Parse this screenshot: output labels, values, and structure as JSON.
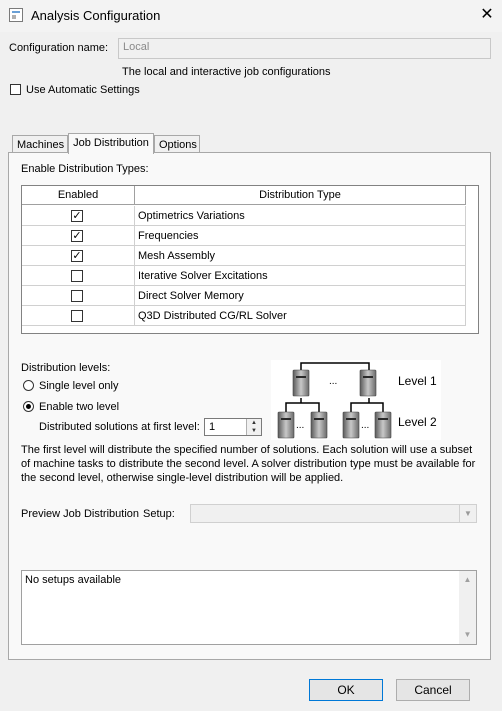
{
  "window": {
    "title": "Analysis Configuration",
    "close_label": "✕"
  },
  "config": {
    "name_label": "Configuration name:",
    "name_value": "Local",
    "description": "The local and interactive job configurations",
    "auto_settings_label": "Use Automatic Settings"
  },
  "tabs": [
    {
      "label": "Machines",
      "active": false
    },
    {
      "label": "Job Distribution",
      "active": true
    },
    {
      "label": "Options",
      "active": false
    }
  ],
  "distribution": {
    "section_label": "Enable Distribution Types:",
    "columns": [
      "Enabled",
      "Distribution Type"
    ],
    "rows": [
      {
        "enabled": true,
        "type": "Optimetrics Variations"
      },
      {
        "enabled": true,
        "type": "Frequencies"
      },
      {
        "enabled": true,
        "type": "Mesh Assembly"
      },
      {
        "enabled": false,
        "type": "Iterative Solver Excitations"
      },
      {
        "enabled": false,
        "type": "Direct Solver Memory"
      },
      {
        "enabled": false,
        "type": "Q3D Distributed CG/RL Solver"
      }
    ]
  },
  "levels": {
    "label": "Distribution levels:",
    "single_label": "Single level only",
    "two_label": "Enable two level",
    "selected": "two",
    "first_level_label": "Distributed solutions at first level:",
    "first_level_value": "1",
    "diagram_level1": "Level 1",
    "diagram_level2": "Level 2",
    "diagram_ellipsis": "...",
    "description": "The first level will distribute the specified number of solutions. Each solution will use a subset of machine tasks to distribute the second level. A solver distribution type must be available for the second level, otherwise single-level distribution will be applied."
  },
  "preview": {
    "label": "Preview Job Distribution",
    "setup_label": "Setup:",
    "setup_value": "",
    "output": "No setups available"
  },
  "buttons": {
    "ok": "OK",
    "cancel": "Cancel"
  }
}
